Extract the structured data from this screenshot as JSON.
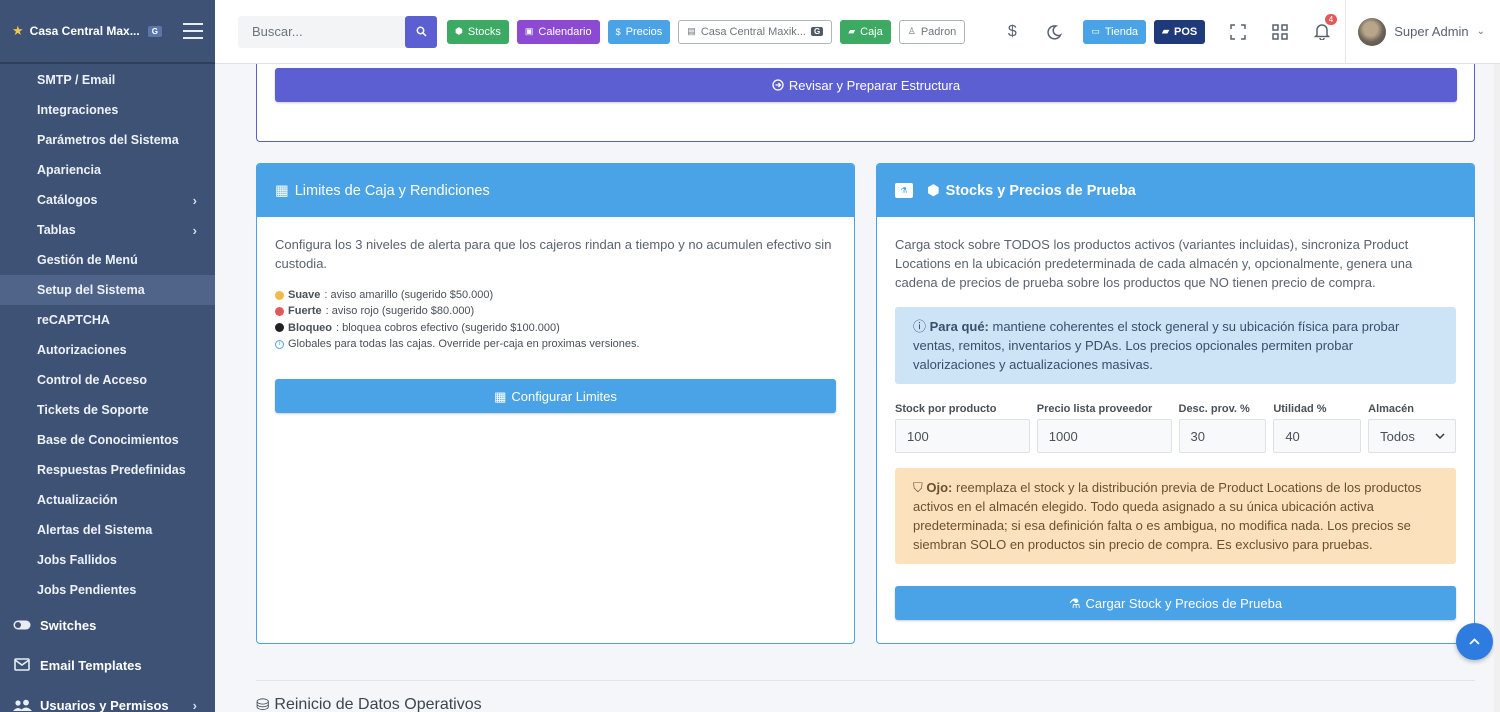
{
  "brand": {
    "name": "Casa Central Max...",
    "badge": "G"
  },
  "sidebar": {
    "items": [
      {
        "label": "SMTP / Email",
        "chevron": false
      },
      {
        "label": "Integraciones",
        "chevron": false
      },
      {
        "label": "Parámetros del Sistema",
        "chevron": false
      },
      {
        "label": "Apariencia",
        "chevron": false
      },
      {
        "label": "Catálogos",
        "chevron": true
      },
      {
        "label": "Tablas",
        "chevron": true
      },
      {
        "label": "Gestión de Menú",
        "chevron": false
      },
      {
        "label": "Setup del Sistema",
        "chevron": false,
        "active": true
      },
      {
        "label": "reCAPTCHA",
        "chevron": false
      },
      {
        "label": "Autorizaciones",
        "chevron": false
      },
      {
        "label": "Control de Acceso",
        "chevron": false
      },
      {
        "label": "Tickets de Soporte",
        "chevron": false
      },
      {
        "label": "Base de Conocimientos",
        "chevron": false
      },
      {
        "label": "Respuestas Predefinidas",
        "chevron": false
      },
      {
        "label": "Actualización",
        "chevron": false
      },
      {
        "label": "Alertas del Sistema",
        "chevron": false
      },
      {
        "label": "Jobs Fallidos",
        "chevron": false
      },
      {
        "label": "Jobs Pendientes",
        "chevron": false
      }
    ],
    "sections": [
      {
        "label": "Switches",
        "icon": "toggle-icon"
      },
      {
        "label": "Email Templates",
        "icon": "email-edit-icon"
      },
      {
        "label": "Usuarios y Permisos",
        "icon": "users-icon"
      }
    ]
  },
  "topbar": {
    "search_placeholder": "Buscar...",
    "stocks": "Stocks",
    "calendario": "Calendario",
    "precios": "Precios",
    "casa": "Casa Central Maxik...",
    "casa_badge": "G",
    "caja": "Caja",
    "padron": "Padron",
    "tienda": "Tienda",
    "pos": "POS",
    "notifications": "4",
    "user": "Super Admin"
  },
  "top_card": {
    "button": "Revisar y Preparar Estructura"
  },
  "limits_card": {
    "title": "Limites de Caja y Rendiciones",
    "description": "Configura los 3 niveles de alerta para que los cajeros rindan a tiempo y no acumulen efectivo sin custodia.",
    "levels": [
      {
        "name": "Suave",
        "text": ": aviso amarillo (sugerido $50.000)",
        "color": "#f3b84a"
      },
      {
        "name": "Fuerte",
        "text": ": aviso rojo (sugerido $80.000)",
        "color": "#e15a5a"
      },
      {
        "name": "Bloqueo",
        "text": ": bloquea cobros efectivo (sugerido $100.000)",
        "color": "#222222"
      }
    ],
    "note": "Globales para todas las cajas. Override per-caja en proximas versiones.",
    "button": "Configurar Limites"
  },
  "stocks_card": {
    "title": "Stocks y Precios de Prueba",
    "description": "Carga stock sobre TODOS los productos activos (variantes incluidas), sincroniza Product Locations en la ubicación predeterminada de cada almacén y, opcionalmente, genera una cadena de precios de prueba sobre los productos que NO tienen precio de compra.",
    "info_strong": "Para qué:",
    "info_text": " mantiene coherentes el stock general y su ubicación física para probar ventas, remitos, inventarios y PDAs. Los precios opcionales permiten probar valorizaciones y actualizaciones masivas.",
    "fields": {
      "stock_label": "Stock por producto",
      "stock_value": "100",
      "precio_label": "Precio lista proveedor",
      "precio_value": "1000",
      "desc_label": "Desc. prov. %",
      "desc_value": "30",
      "util_label": "Utilidad %",
      "util_value": "40",
      "almacen_label": "Almacén",
      "almacen_value": "Todos"
    },
    "warn_strong": "Ojo:",
    "warn_text": " reemplaza el stock y la distribución previa de Product Locations de los productos activos en el almacén elegido. Todo queda asignado a su única ubicación activa predeterminada; si esa definición falta o es ambigua, no modifica nada. Los precios se siembran SOLO en productos sin precio de compra. Es exclusivo para pruebas.",
    "button": "Cargar Stock y Precios de Prueba"
  },
  "next_section": {
    "title": "Reinicio de Datos Operativos"
  }
}
